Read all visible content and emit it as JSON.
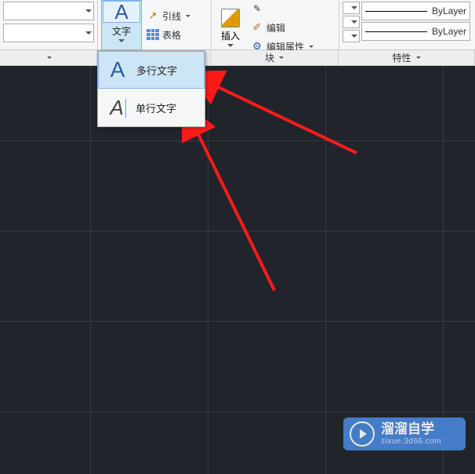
{
  "ribbon": {
    "text_panel": {
      "big_button_label": "文字",
      "big_icon_letter": "A",
      "leader_label": "引线",
      "table_label": "表格"
    },
    "block_panel": {
      "insert_label": "插入",
      "edit_label": "编辑",
      "edit_attr_label": "编辑属性",
      "footer": "块"
    },
    "props_panel": {
      "bylayer_label_1": "ByLayer",
      "bylayer_label_2": "ByLayer",
      "footer": "特性"
    }
  },
  "dropdown": {
    "multi_text": "多行文字",
    "single_text": "单行文字"
  },
  "watermark": {
    "title": "溜溜自学",
    "sub": "zixue.3d66.com"
  },
  "colors": {
    "accent": "#4a86d8",
    "canvas": "#21252b"
  }
}
